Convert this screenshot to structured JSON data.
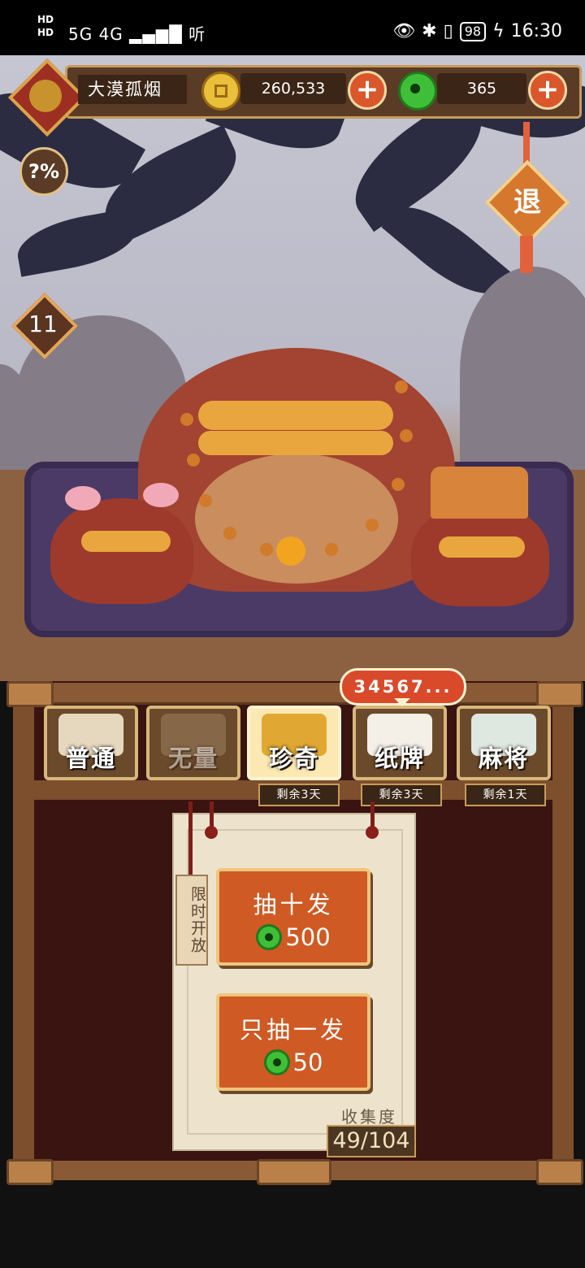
{
  "status_bar": {
    "sim1": "HD",
    "sim2": "HD",
    "network": "5G 4G",
    "listen": "听",
    "battery": "98",
    "time": "16:30"
  },
  "player": {
    "name": "大漠孤烟",
    "gold": "260,533",
    "jade": "365"
  },
  "buttons": {
    "help": "?%",
    "exit": "退",
    "level": "11"
  },
  "tabs": [
    {
      "label": "普通",
      "tag": ""
    },
    {
      "label": "无量",
      "tag": ""
    },
    {
      "label": "珍奇",
      "tag": "剩余3天"
    },
    {
      "label": "纸牌",
      "tag": "剩余3天"
    },
    {
      "label": "麻将",
      "tag": "剩余1天"
    }
  ],
  "bubble": "34567...",
  "limited_tag": "限时开放",
  "draw_ten": {
    "title": "抽十发",
    "cost": "500"
  },
  "draw_one": {
    "title": "只抽一发",
    "cost": "50"
  },
  "collection": {
    "label": "收集度",
    "value": "49/104"
  },
  "colors": {
    "accent": "#cf5a23",
    "jade": "#3fbf38",
    "gold": "#e9c03a",
    "panel": "#3a1410"
  }
}
